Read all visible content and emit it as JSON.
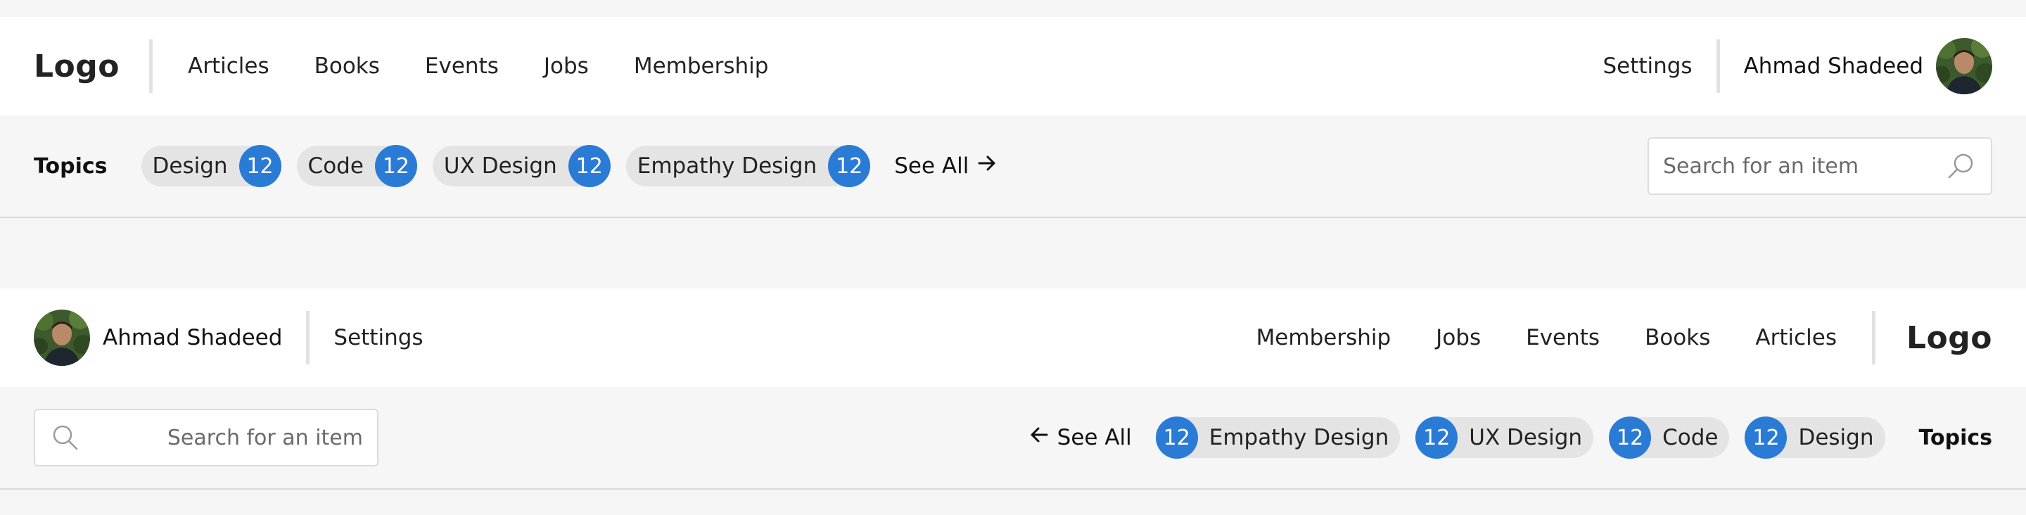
{
  "header": {
    "logo": "Logo",
    "nav": [
      "Articles",
      "Books",
      "Events",
      "Jobs",
      "Membership"
    ],
    "settings": "Settings",
    "user_name": "Ahmad Shadeed"
  },
  "topics": {
    "label": "Topics",
    "chips": [
      {
        "label": "Design",
        "count": "12"
      },
      {
        "label": "Code",
        "count": "12"
      },
      {
        "label": "UX Design",
        "count": "12"
      },
      {
        "label": "Empathy Design",
        "count": "12"
      }
    ],
    "see_all": "See All"
  },
  "search": {
    "placeholder": "Search for an item"
  },
  "colors": {
    "accent": "#2a7bd5",
    "chip_bg": "#e4e4e4",
    "page_bg": "#f5f5f5"
  },
  "icons": [
    "search-icon",
    "arrow-right-icon",
    "arrow-left-icon",
    "avatar"
  ]
}
